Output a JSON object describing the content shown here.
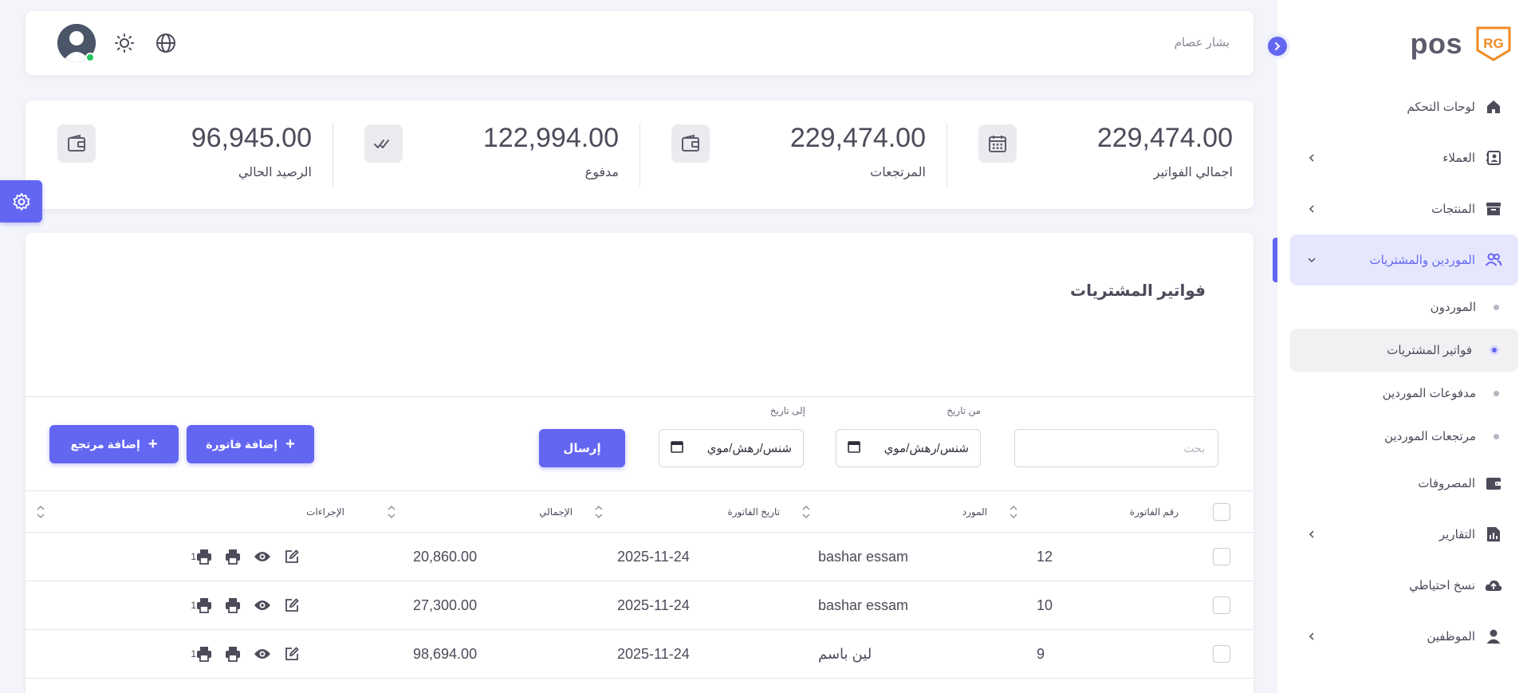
{
  "brand": {
    "name": "pos",
    "logo_text": "RG"
  },
  "colors": {
    "accent": "#6366f1",
    "text": "#4b4b5a",
    "muted": "#8a8a98",
    "online": "#22c55e",
    "logo": "#f08a24"
  },
  "topbar": {
    "user_name": "بشار عصام",
    "icons": [
      "theme-toggle-icon",
      "globe-icon",
      "avatar"
    ]
  },
  "sidebar": {
    "items": [
      {
        "label": "لوحات التحكم",
        "icon": "home-icon",
        "has_children": false
      },
      {
        "label": "العملاء",
        "icon": "contacts-icon",
        "has_children": true
      },
      {
        "label": "المنتجات",
        "icon": "archive-icon",
        "has_children": true
      },
      {
        "label": "الموردين والمشتريات",
        "icon": "users-icon",
        "has_children": true,
        "active": true,
        "children": [
          {
            "label": "الموردون"
          },
          {
            "label": "فواتير المشتريات",
            "current": true
          },
          {
            "label": "مدفوعات الموردين"
          },
          {
            "label": "مرتجعات الموردين"
          }
        ]
      },
      {
        "label": "المصروفات",
        "icon": "wallet-icon",
        "has_children": false
      },
      {
        "label": "التقارير",
        "icon": "report-icon",
        "has_children": true
      },
      {
        "label": "نسخ احتياطي",
        "icon": "cloud-icon",
        "has_children": false
      },
      {
        "label": "الموظفين",
        "icon": "person-icon",
        "has_children": true
      }
    ]
  },
  "stats": [
    {
      "value": "229,474.00",
      "label": "اجمالي الفواتير",
      "icon": "calendar-icon"
    },
    {
      "value": "229,474.00",
      "label": "المرتجعات",
      "icon": "wallet-icon"
    },
    {
      "value": "122,994.00",
      "label": "مدفوع",
      "icon": "double-check-icon"
    },
    {
      "value": "96,945.00",
      "label": "الرصيد الحالي",
      "icon": "wallet-icon"
    }
  ],
  "page": {
    "title": "فواتير المشتريات",
    "search_placeholder": "بحث",
    "from_date_label": "من تاريخ",
    "to_date_label": "إلى تاريخ",
    "date_placeholder": "ﺷﻨﺲ/ﺭﻫﺶ/ﻣﻮﻱ",
    "send_label": "إرسال",
    "add_invoice_label": "إضافة فاتورة",
    "add_return_label": "إضافة مرتجع"
  },
  "table": {
    "columns": [
      "رقم الفاتورة",
      "المورد",
      "تاريخ الفاتورة",
      "الإجمالي",
      "الإجراءات"
    ],
    "rows": [
      {
        "number": "12",
        "supplier": "bashar essam",
        "date": "2025-11-24",
        "total": "20,860.00",
        "badge": "1"
      },
      {
        "number": "10",
        "supplier": "bashar essam",
        "date": "2025-11-24",
        "total": "27,300.00",
        "badge": "1"
      },
      {
        "number": "9",
        "supplier": "لين باسم",
        "date": "2025-11-24",
        "total": "98,694.00",
        "badge": "1"
      }
    ]
  }
}
